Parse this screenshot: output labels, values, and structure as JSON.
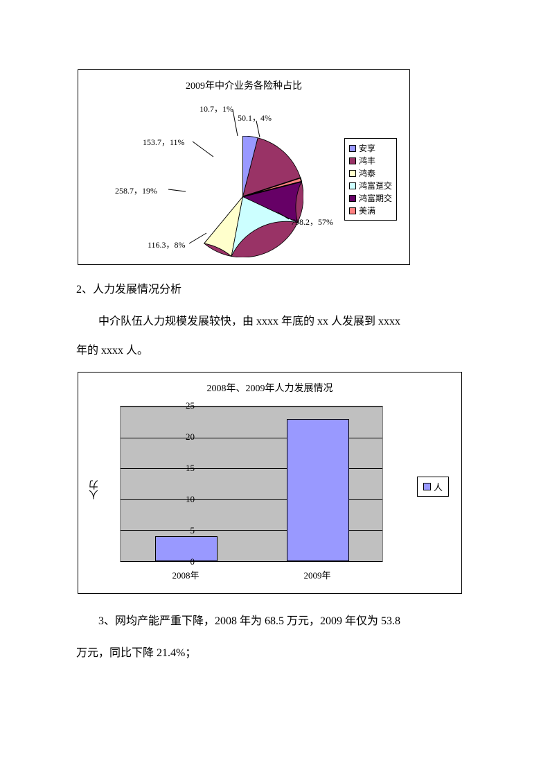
{
  "chart_data": [
    {
      "type": "pie",
      "title": "2009年中介业务各险种占比",
      "series": [
        {
          "name": "安享",
          "value": 50.1,
          "pct": 4,
          "color": "#9999ff",
          "label": "50.1，4%"
        },
        {
          "name": "鸿丰",
          "value": 798.2,
          "pct": 57,
          "color": "#993366",
          "label": "798.2，57%"
        },
        {
          "name": "鸿泰",
          "value": 116.3,
          "pct": 8,
          "color": "#ffffcc",
          "label": "116.3，8%"
        },
        {
          "name": "鸿富趸交",
          "value": 258.7,
          "pct": 19,
          "color": "#ccffff",
          "label": "258.7，19%"
        },
        {
          "name": "鸿富期交",
          "value": 153.7,
          "pct": 11,
          "color": "#660066",
          "label": "153.7，11%"
        },
        {
          "name": "美满",
          "value": 10.7,
          "pct": 1,
          "color": "#ff8080",
          "label": "10.7，1%"
        }
      ]
    },
    {
      "type": "bar",
      "title": "2008年、2009年人力发展情况",
      "ylabel": "人力",
      "ylim": [
        0,
        25
      ],
      "yticks": [
        0,
        5,
        10,
        15,
        20,
        25
      ],
      "categories": [
        "2008年",
        "2009年"
      ],
      "series": [
        {
          "name": "人",
          "values": [
            4,
            23
          ],
          "color": "#9999ff"
        }
      ]
    }
  ],
  "text": {
    "section2": "2、人力发展情况分析",
    "para1a": "中介队伍人力规模发展较快，由 ",
    "para1b": "xxxx ",
    "para1c": "年底的 ",
    "para1d": "xx ",
    "para1e": "人发展到 ",
    "para1f": "xxxx",
    "para2a": "年的 ",
    "para2b": "xxxx ",
    "para2c": "人。",
    "para3": "3、网均产能严重下降，2008 年为 68.5 万元，2009 年仅为 53.8",
    "para4": "万元，同比下降 21.4%；"
  }
}
